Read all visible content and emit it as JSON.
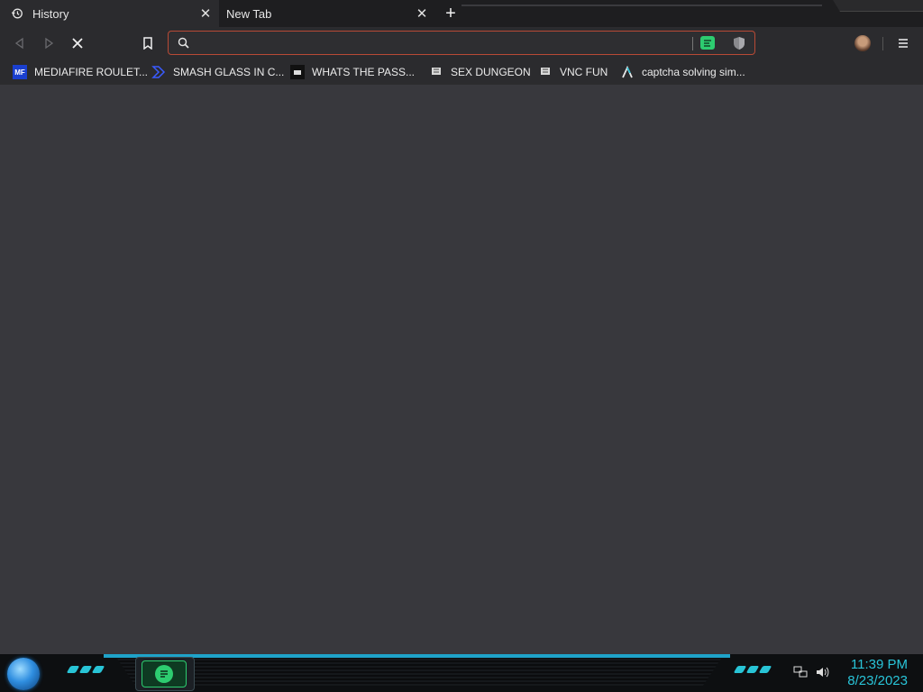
{
  "tabs": [
    {
      "label": "History",
      "icon": "history-icon",
      "active": true
    },
    {
      "label": "New Tab",
      "icon": null,
      "active": false
    }
  ],
  "nav": {
    "back_icon": "back-icon",
    "forward_icon": "forward-icon",
    "stop_icon": "stop-icon",
    "bookmark_icon": "bookmark-icon",
    "url_value": "",
    "menu_icon": "menu-icon"
  },
  "bookmarks": [
    {
      "label": "MEDIAFIRE ROULET...",
      "icon": "mediafire-icon"
    },
    {
      "label": "SMASH GLASS IN C...",
      "icon": "chevron-logo-icon"
    },
    {
      "label": "WHATS THE PASS...",
      "icon": "box-site-icon"
    },
    {
      "label": "SEX DUNGEON",
      "icon": "stamp-icon"
    },
    {
      "label": "VNC FUN",
      "icon": "stamp-icon"
    },
    {
      "label": "captcha solving sim...",
      "icon": "lambda-icon"
    }
  ],
  "taskbar": {
    "time": "11:39 PM",
    "date": "8/23/2023"
  },
  "colors": {
    "accent_cyan": "#29c4d8",
    "url_border": "#b84a35",
    "ext_green": "#2dcc70",
    "background": "#38383d"
  }
}
